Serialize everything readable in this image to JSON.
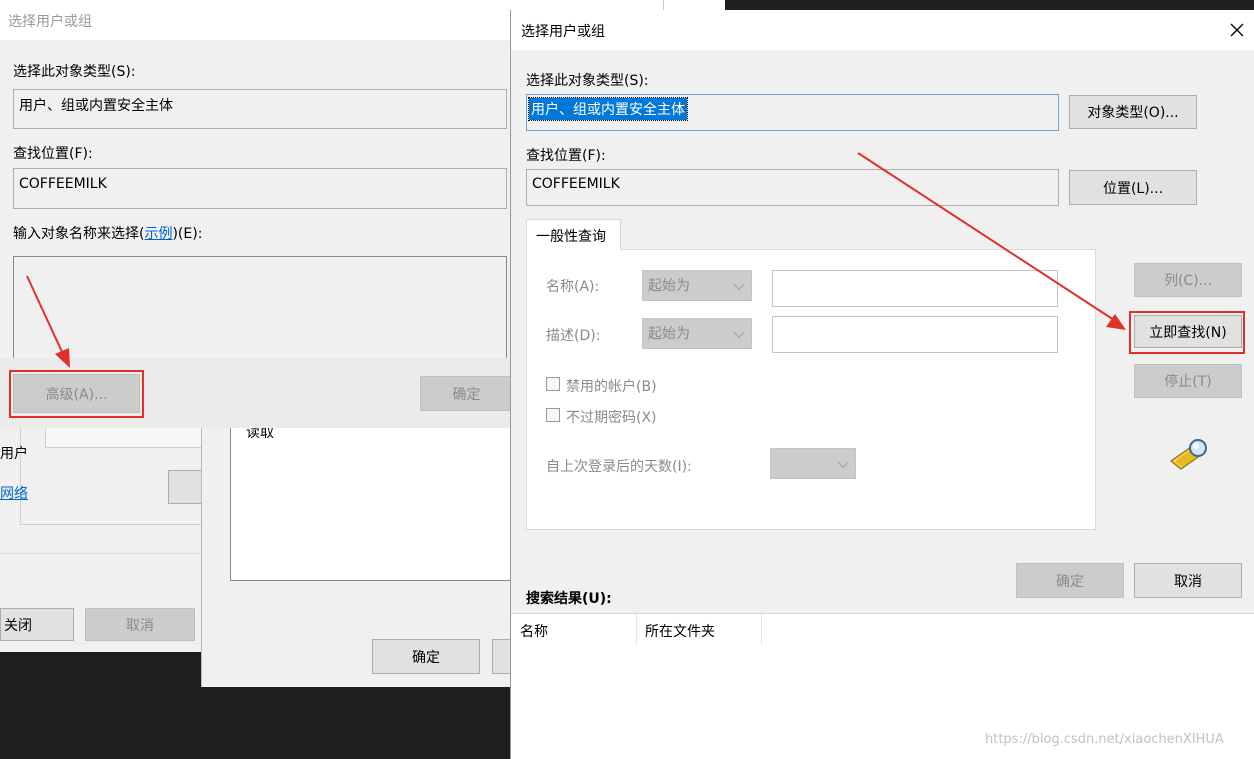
{
  "colors": {
    "annotation": "#e0302b",
    "link": "#0066cc",
    "selection": "#0078d7"
  },
  "back_bottom": {
    "user_fragment": "用户",
    "network_fragment": "网络",
    "close_button": "关闭",
    "cancel_button": "取消"
  },
  "back_middle": {
    "read_label": "读取",
    "ok_button": "确定"
  },
  "left_dialog": {
    "title": "选择用户或组",
    "object_type_label": "选择此对象类型(S):",
    "object_type_value": "用户、组或内置安全主体",
    "location_label": "查找位置(F):",
    "location_value": "COFFEEMILK",
    "enter_names_prefix": "输入对象名称来选择(",
    "enter_names_link": "示例",
    "enter_names_suffix": ")(E):",
    "advanced_button": "高级(A)...",
    "ok_button": "确定"
  },
  "right_dialog": {
    "title": "选择用户或组",
    "close_icon": "close-icon",
    "object_type_label": "选择此对象类型(S):",
    "object_type_value": "用户、组或内置安全主体",
    "object_types_button": "对象类型(O)...",
    "location_label": "查找位置(F):",
    "location_value": "COFFEEMILK",
    "locations_button": "位置(L)...",
    "tab_label": "一般性查询",
    "name_label": "名称(A):",
    "name_combo": "起始为",
    "description_label": "描述(D):",
    "description_combo": "起始为",
    "disabled_accounts_label": "禁用的帐户(B)",
    "non_expiring_label": "不过期密码(X)",
    "days_since_label": "自上次登录后的天数(I):",
    "columns_button": "列(C)...",
    "find_now_button": "立即查找(N)",
    "stop_button": "停止(T)",
    "search_icon": "search-flashlight-icon",
    "ok_button": "确定",
    "cancel_button": "取消",
    "results_label": "搜索结果(U):",
    "results_columns": [
      "名称",
      "所在文件夹"
    ]
  },
  "watermark": "https://blog.csdn.net/xiaochenXIHUA"
}
